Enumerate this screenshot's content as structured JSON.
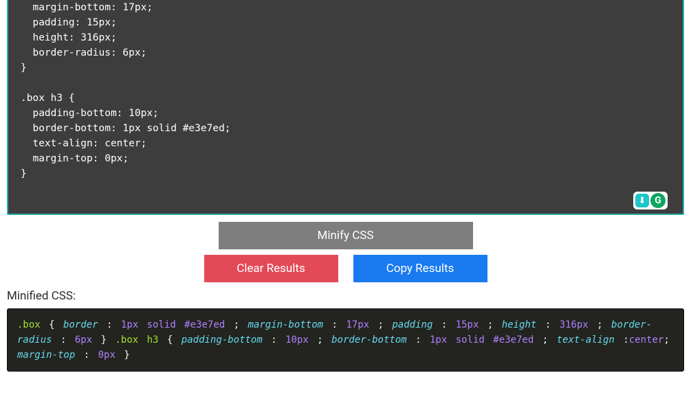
{
  "editor": {
    "css_text": "  margin-bottom: 17px;\n  padding: 15px;\n  height: 316px;\n  border-radius: 6px;\n}\n\n.box h3 {\n  padding-bottom: 10px;\n  border-bottom: 1px solid #e3e7ed;\n  text-align: center;\n  margin-top: 0px;\n}"
  },
  "badges": {
    "grammarly": "G",
    "other": "⬇"
  },
  "buttons": {
    "minify": "Minify CSS",
    "clear": "Clear Results",
    "copy": "Copy Results"
  },
  "result": {
    "label": "Minified CSS:",
    "tokens": [
      {
        "t": "sel",
        "v": ".box"
      },
      {
        "t": "punc",
        "v": " { "
      },
      {
        "t": "prop",
        "v": "border"
      },
      {
        "t": "punc",
        "v": " : "
      },
      {
        "t": "val",
        "v": "1px  solid  #e3e7ed"
      },
      {
        "t": "punc",
        "v": " ; "
      },
      {
        "t": "prop",
        "v": "margin-bottom"
      },
      {
        "t": "punc",
        "v": " : "
      },
      {
        "t": "val",
        "v": "17px"
      },
      {
        "t": "punc",
        "v": " ; "
      },
      {
        "t": "prop",
        "v": "padding"
      },
      {
        "t": "punc",
        "v": " : "
      },
      {
        "t": "val",
        "v": "15px"
      },
      {
        "t": "punc",
        "v": " ; "
      },
      {
        "t": "prop",
        "v": "height"
      },
      {
        "t": "punc",
        "v": " : "
      },
      {
        "t": "val",
        "v": "316px"
      },
      {
        "t": "punc",
        "v": " ; "
      },
      {
        "t": "prop",
        "v": "border-radius"
      },
      {
        "t": "punc",
        "v": " : "
      },
      {
        "t": "val",
        "v": "6px"
      },
      {
        "t": "punc",
        "v": " } "
      },
      {
        "t": "sel",
        "v": ".box   h3"
      },
      {
        "t": "punc",
        "v": " { "
      },
      {
        "t": "prop",
        "v": "padding-bottom"
      },
      {
        "t": "punc",
        "v": " : "
      },
      {
        "t": "val",
        "v": "10px"
      },
      {
        "t": "punc",
        "v": " ; "
      },
      {
        "t": "prop",
        "v": "border-bottom"
      },
      {
        "t": "punc",
        "v": " : "
      },
      {
        "t": "val",
        "v": "1px  solid  #e3e7ed"
      },
      {
        "t": "punc",
        "v": " ; "
      },
      {
        "t": "prop",
        "v": "text-align"
      },
      {
        "t": "punc",
        "v": " :"
      },
      {
        "t": "val",
        "v": "center"
      },
      {
        "t": "punc",
        "v": "; "
      },
      {
        "t": "prop",
        "v": "margin-top"
      },
      {
        "t": "punc",
        "v": " : "
      },
      {
        "t": "val",
        "v": "0px"
      },
      {
        "t": "punc",
        "v": " }"
      }
    ]
  }
}
